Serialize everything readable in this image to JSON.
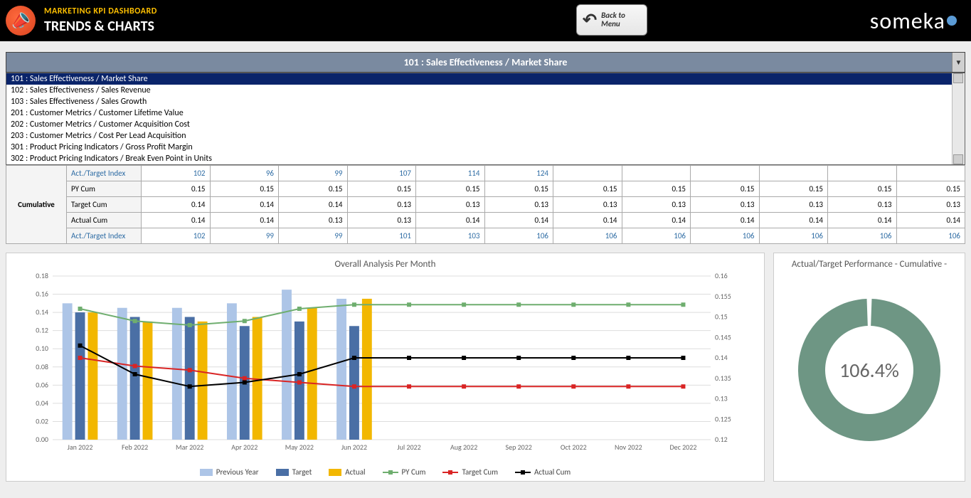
{
  "header": {
    "title1": "MARKETING KPI DASHBOARD",
    "title2": "TRENDS & CHARTS",
    "back": "Back to Menu",
    "brand": "someka"
  },
  "dropdown": {
    "selected": "101 : Sales Effectiveness / Market Share",
    "items": [
      "101 : Sales Effectiveness / Market Share",
      "102 : Sales Effectiveness / Sales Revenue",
      "103 : Sales Effectiveness / Sales Growth",
      "201 : Customer Metrics / Customer Lifetime Value",
      "202 : Customer Metrics / Customer Acquisition Cost",
      "203 : Customer Metrics / Cost Per Lead Acquisition",
      "301 : Product Pricing Indicators / Gross Profit Margin",
      "302 : Product Pricing Indicators / Break Even Point in Units"
    ]
  },
  "table": {
    "group": "Cumulative",
    "rows": [
      {
        "label": "Act./Target Index",
        "class": "idx",
        "values": [
          "102",
          "96",
          "99",
          "107",
          "114",
          "124",
          "",
          "",
          "",
          "",
          "",
          ""
        ]
      },
      {
        "label": "PY Cum",
        "class": "",
        "values": [
          "0.15",
          "0.15",
          "0.15",
          "0.15",
          "0.15",
          "0.15",
          "0.15",
          "0.15",
          "0.15",
          "0.15",
          "0.15",
          "0.15"
        ]
      },
      {
        "label": "Target Cum",
        "class": "",
        "values": [
          "0.14",
          "0.14",
          "0.14",
          "0.13",
          "0.13",
          "0.13",
          "0.13",
          "0.13",
          "0.13",
          "0.13",
          "0.13",
          "0.13"
        ]
      },
      {
        "label": "Actual Cum",
        "class": "",
        "values": [
          "0.14",
          "0.14",
          "0.13",
          "0.13",
          "0.14",
          "0.14",
          "0.14",
          "0.14",
          "0.14",
          "0.14",
          "0.14",
          "0.14"
        ]
      },
      {
        "label": "Act./Target Index",
        "class": "idx",
        "values": [
          "102",
          "99",
          "99",
          "101",
          "103",
          "106",
          "106",
          "106",
          "106",
          "106",
          "106",
          "106"
        ]
      }
    ]
  },
  "chart_data": [
    {
      "type": "bar+line",
      "title": "Overall Analysis Per Month",
      "categories": [
        "Jan 2022",
        "Feb 2022",
        "Mar 2022",
        "Apr 2022",
        "May 2022",
        "Jun 2022",
        "Jul 2022",
        "Aug 2022",
        "Sep 2022",
        "Oct 2022",
        "Nov 2022",
        "Dec 2022"
      ],
      "y_left": {
        "min": 0,
        "max": 0.18,
        "step": 0.02
      },
      "y_right": {
        "min": 0.12,
        "max": 0.16,
        "step": 0.005
      },
      "series_bars": [
        {
          "name": "Previous Year",
          "color": "#adc5e7",
          "values": [
            0.15,
            0.145,
            0.145,
            0.15,
            0.165,
            0.155,
            null,
            null,
            null,
            null,
            null,
            null
          ]
        },
        {
          "name": "Target",
          "color": "#4a6fa5",
          "values": [
            0.14,
            0.135,
            0.135,
            0.125,
            0.13,
            0.125,
            null,
            null,
            null,
            null,
            null,
            null
          ]
        },
        {
          "name": "Actual",
          "color": "#f2b700",
          "values": [
            0.14,
            0.13,
            0.13,
            0.135,
            0.145,
            0.155,
            null,
            null,
            null,
            null,
            null,
            null
          ]
        }
      ],
      "series_lines": [
        {
          "name": "PY Cum",
          "color": "#6fae6f",
          "axis": "right",
          "values": [
            0.152,
            0.149,
            0.148,
            0.149,
            0.152,
            0.153,
            0.153,
            0.153,
            0.153,
            0.153,
            0.153,
            0.153
          ]
        },
        {
          "name": "Target Cum",
          "color": "#d92525",
          "axis": "right",
          "values": [
            0.14,
            0.138,
            0.137,
            0.135,
            0.134,
            0.133,
            0.133,
            0.133,
            0.133,
            0.133,
            0.133,
            0.133
          ]
        },
        {
          "name": "Actual Cum",
          "color": "#000000",
          "axis": "right",
          "values": [
            0.143,
            0.136,
            0.133,
            0.134,
            0.136,
            0.14,
            0.14,
            0.14,
            0.14,
            0.14,
            0.14,
            0.14
          ]
        }
      ],
      "legend": [
        "Previous Year",
        "Target",
        "Actual",
        "PY Cum",
        "Target Cum",
        "Actual Cum"
      ]
    },
    {
      "type": "donut",
      "title": "Actual/Target Performance - Cumulative -",
      "value_pct": 106.4,
      "color": "#6e9684"
    }
  ]
}
